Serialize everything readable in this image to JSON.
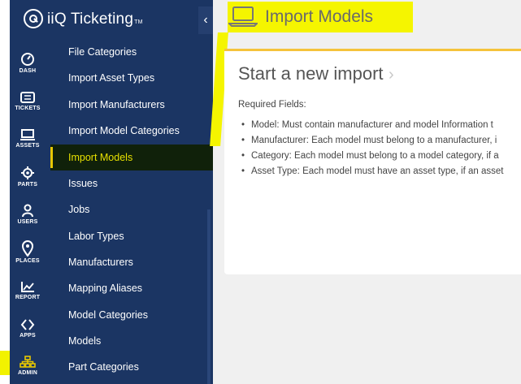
{
  "brand": {
    "name": "iiQ Ticketing",
    "tm": "TM"
  },
  "collapse": {
    "glyph": "‹"
  },
  "rail": [
    {
      "label": "DASH",
      "icon": "dashboard-icon"
    },
    {
      "label": "TICKETS",
      "icon": "ticket-icon"
    },
    {
      "label": "ASSETS",
      "icon": "laptop-icon"
    },
    {
      "label": "PARTS",
      "icon": "gear-icon"
    },
    {
      "label": "USERS",
      "icon": "user-icon"
    },
    {
      "label": "PLACES",
      "icon": "location-pin-icon"
    },
    {
      "label": "REPORT",
      "icon": "chart-icon"
    },
    {
      "label": "APPS",
      "icon": "apps-icon"
    },
    {
      "label": "ADMIN",
      "icon": "org-chart-icon"
    }
  ],
  "menu": [
    "File Categories",
    "Import Asset Types",
    "Import Manufacturers",
    "Import Model Categories",
    "Import Models",
    "Issues",
    "Jobs",
    "Labor Types",
    "Manufacturers",
    "Mapping Aliases",
    "Model Categories",
    "Models",
    "Part Categories"
  ],
  "page": {
    "title": "Import Models"
  },
  "card": {
    "title": "Start a new import",
    "chevron": "›",
    "required_label": "Required Fields:",
    "fields": [
      "Model:  Must contain manufacturer and model Information t",
      "Manufacturer:  Each model must belong to a manufacturer, i",
      "Category:  Each model must belong to a model category, if a",
      "Asset Type:  Each model must have an asset type, if an asset"
    ]
  },
  "colors": {
    "sidebar": "#1b3563",
    "active_text": "#e7e000",
    "highlight": "#f5f500",
    "card_accent": "#f5c33b"
  }
}
